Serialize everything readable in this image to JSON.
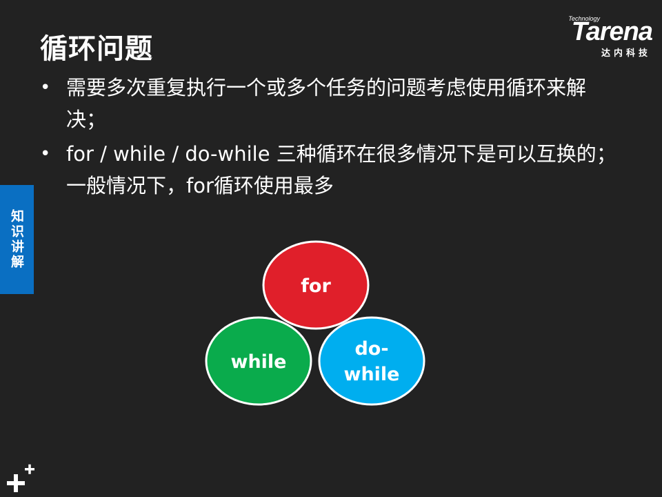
{
  "slide": {
    "title": "循环问题",
    "bullets": [
      {
        "dot": "•",
        "text": "需要多次重复执行一个或多个任务的问题考虑使用循环来解决；"
      },
      {
        "dot": "•",
        "text": "for / while / do-while 三种循环在很多情况下是可以互换的；一般情况下，for循环使用最多"
      }
    ]
  },
  "logo": {
    "tagline": "Technology",
    "brand": "Tarena",
    "subtitle": "达内科技"
  },
  "side_tab": {
    "label": "知识讲解"
  },
  "diagram": {
    "circles": [
      {
        "id": "for",
        "lines": [
          "for"
        ],
        "color": "#e01f2a"
      },
      {
        "id": "while",
        "lines": [
          "while"
        ],
        "color": "#0aab4c"
      },
      {
        "id": "do-while",
        "lines": [
          "do-",
          "while"
        ],
        "color": "#00aeef"
      }
    ],
    "outline_color": "#ffffff"
  }
}
